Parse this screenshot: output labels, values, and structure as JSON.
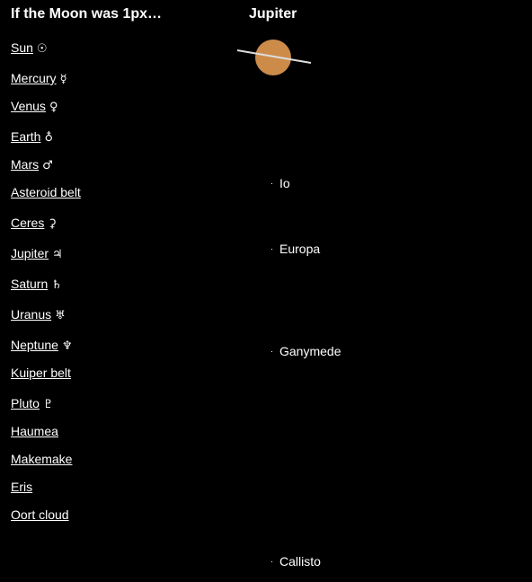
{
  "site_title": "If the Moon was 1px…",
  "nav": [
    {
      "label": "Sun",
      "symbol": "☉"
    },
    {
      "label": "Mercury",
      "symbol": "☿"
    },
    {
      "label": "Venus",
      "symbol": "♀"
    },
    {
      "label": "Earth",
      "symbol": "♁"
    },
    {
      "label": "Mars",
      "symbol": "♂"
    },
    {
      "label": "Asteroid belt",
      "symbol": ""
    },
    {
      "label": "Ceres",
      "symbol": "⚳"
    },
    {
      "label": "Jupiter",
      "symbol": "♃"
    },
    {
      "label": "Saturn",
      "symbol": "♄"
    },
    {
      "label": "Uranus",
      "symbol": "♅"
    },
    {
      "label": "Neptune",
      "symbol": "♆"
    },
    {
      "label": "Kuiper belt",
      "symbol": ""
    },
    {
      "label": "Pluto",
      "symbol": "♇"
    },
    {
      "label": "Haumea",
      "symbol": ""
    },
    {
      "label": "Makemake",
      "symbol": ""
    },
    {
      "label": "Eris",
      "symbol": ""
    },
    {
      "label": "Oort cloud",
      "symbol": ""
    }
  ],
  "planet": {
    "title": "Jupiter",
    "color": "#cd8b4a",
    "axis_color": "#dddddd"
  },
  "moons": [
    {
      "name": "Io"
    },
    {
      "name": "Europa"
    },
    {
      "name": "Ganymede"
    },
    {
      "name": "Callisto"
    }
  ]
}
